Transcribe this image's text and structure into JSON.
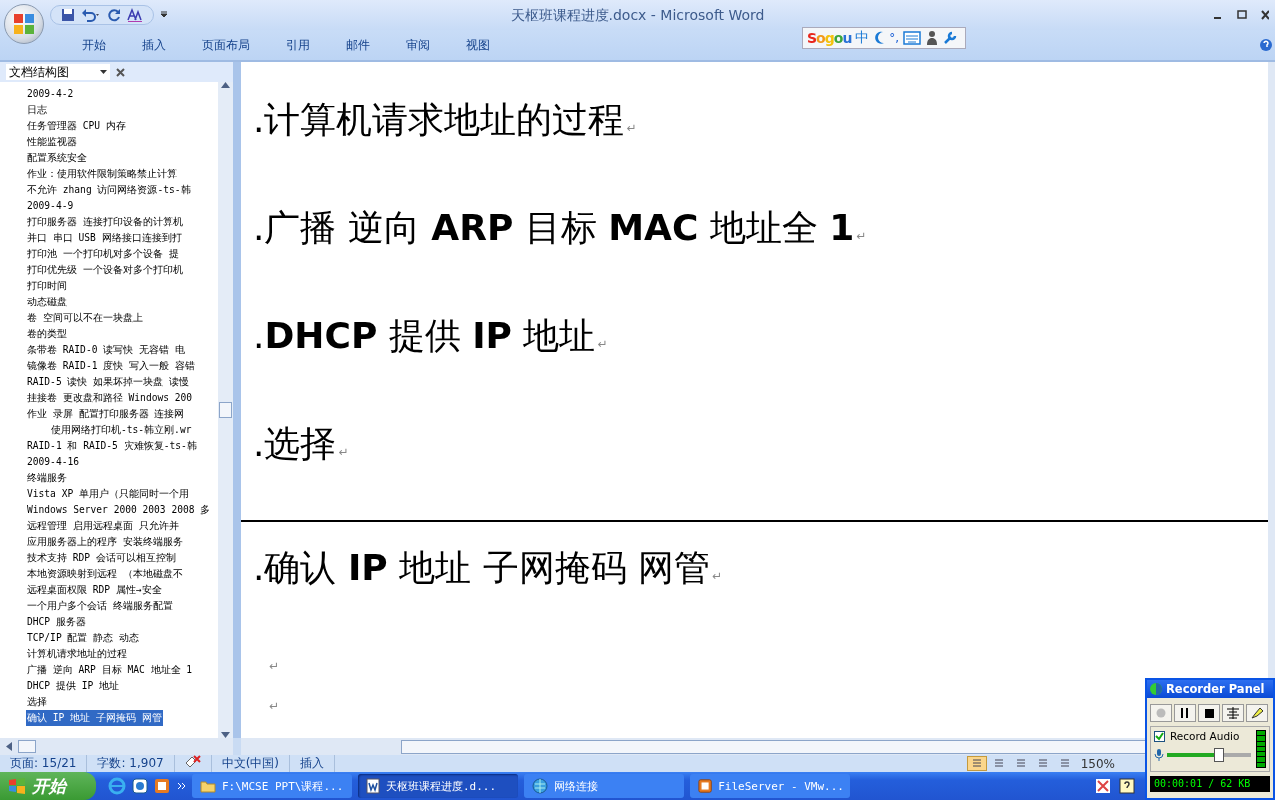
{
  "window": {
    "title": "天枢班课程进度.docx - Microsoft Word"
  },
  "ribbon_tabs": [
    {
      "label": "开始",
      "selected": false
    },
    {
      "label": "插入",
      "selected": false
    },
    {
      "label": "页面布局",
      "selected": false
    },
    {
      "label": "引用",
      "selected": false
    },
    {
      "label": "邮件",
      "selected": false
    },
    {
      "label": "审阅",
      "selected": false
    },
    {
      "label": "视图",
      "selected": false
    }
  ],
  "ime_toolbar": {
    "logo": "Sogou",
    "mode": "中",
    "punctuation": "°,"
  },
  "navigation_pane": {
    "view": "文档结构图",
    "items": [
      {
        "text": "2009-4-2",
        "selected": false
      },
      {
        "text": "日志",
        "selected": false
      },
      {
        "text": "任务管理器 CPU 内存",
        "selected": false
      },
      {
        "text": "性能监视器",
        "selected": false
      },
      {
        "text": "配置系统安全",
        "selected": false
      },
      {
        "text": "作业：使用软件限制策略禁止计算",
        "selected": false
      },
      {
        "text": "不允许 zhang 访问网络资源-ts-韩",
        "selected": false
      },
      {
        "text": "2009-4-9",
        "selected": false
      },
      {
        "text": "打印服务器 连接打印设备的计算机",
        "selected": false
      },
      {
        "text": "并口 串口 USB 网络接口连接到打",
        "selected": false
      },
      {
        "text": "打印池 一个打印机对多个设备 提",
        "selected": false
      },
      {
        "text": "打印优先级 一个设备对多个打印机",
        "selected": false
      },
      {
        "text": "打印时间",
        "selected": false
      },
      {
        "text": "动态磁盘",
        "selected": false
      },
      {
        "text": "卷 空间可以不在一块盘上",
        "selected": false
      },
      {
        "text": "卷的类型",
        "selected": false
      },
      {
        "text": "条带卷 RAID-0 读写快 无容错 电",
        "selected": false
      },
      {
        "text": "镜像卷 RAID-1 度快 写入一般 容错",
        "selected": false
      },
      {
        "text": "RAID-5 读快 如果坏掉一块盘 读慢",
        "selected": false
      },
      {
        "text": "挂接卷 更改盘和路径 Windows 200",
        "selected": false
      },
      {
        "text": "作业 录屏 配置打印服务器 连接网",
        "selected": false,
        "children": [
          {
            "text": "使用网络打印机-ts-韩立刚.wr",
            "selected": false
          }
        ]
      },
      {
        "text": "RAID-1 和 RAID-5 灾难恢复-ts-韩",
        "selected": false
      },
      {
        "text": "2009-4-16",
        "selected": false
      },
      {
        "text": "终端服务",
        "selected": false
      },
      {
        "text": "Vista XP 单用户（只能同时一个用",
        "selected": false
      },
      {
        "text": "Windows Server 2000 2003 2008 多",
        "selected": false
      },
      {
        "text": "远程管理  启用远程桌面 只允许并",
        "selected": false
      },
      {
        "text": "应用服务器上的程序  安装终端服务",
        "selected": false
      },
      {
        "text": "技术支持 RDP 会话可以相互控制",
        "selected": false
      },
      {
        "text": "本地资源映射到远程 （本地磁盘不",
        "selected": false
      },
      {
        "text": "远程桌面权限 RDP 属性→安全",
        "selected": false
      },
      {
        "text": "一个用户多个会话 终端服务配置",
        "selected": false
      },
      {
        "text": "DHCP 服务器",
        "selected": false
      },
      {
        "text": "TCP/IP 配置 静态 动态",
        "selected": false
      },
      {
        "text": "计算机请求地址的过程",
        "selected": false
      },
      {
        "text": "广播 逆向 ARP 目标 MAC 地址全 1",
        "selected": false
      },
      {
        "text": "DHCP 提供 IP 地址",
        "selected": false
      },
      {
        "text": "选择",
        "selected": false
      },
      {
        "text": "确认 IP 地址 子网掩码 网管",
        "selected": true
      }
    ]
  },
  "document": {
    "paragraphs": [
      {
        "kind": "heading",
        "text": ".计算机请求地址的过程",
        "mark": "↵"
      },
      {
        "kind": "heading",
        "text": ".广播 逆向 **ARP** 目标 **MAC** 地址全 **1**",
        "mark": "↵"
      },
      {
        "kind": "heading",
        "text": ".**DHCP** 提供 **IP** 地址",
        "mark": "↵"
      },
      {
        "kind": "heading",
        "text": ".选择",
        "mark": "↵"
      },
      {
        "kind": "page_break"
      },
      {
        "kind": "heading",
        "text": ".确认 **IP** 地址 子网掩码 网管",
        "mark": "↵"
      },
      {
        "kind": "empty",
        "mark": "↵"
      },
      {
        "kind": "empty",
        "mark": "↵"
      }
    ]
  },
  "status_bar": {
    "page": "页面: 15/21",
    "words": "字数: 1,907",
    "language": "中文(中国)",
    "mode": "插入",
    "zoom": "150%",
    "views": [
      {
        "selected": true
      },
      {
        "selected": false
      },
      {
        "selected": false
      },
      {
        "selected": false
      },
      {
        "selected": false
      }
    ]
  },
  "taskbar": {
    "start": "开始",
    "tasks": [
      {
        "kind": "folder",
        "label": "F:\\MCSE PPT\\课程...",
        "selected": false
      },
      {
        "kind": "document",
        "label": "天枢班课程进度.d...",
        "selected": true
      },
      {
        "kind": "network",
        "label": "网络连接",
        "selected": false
      },
      {
        "kind": "vm",
        "label": "FileServer - VMw...",
        "selected": false
      }
    ]
  },
  "recorder_panel": {
    "title": "Recorder Panel",
    "record_audio": {
      "label": "Record Audio",
      "checked": true
    },
    "volume": {
      "level": 0.62
    },
    "timer": "00:00:01 / 62 KB"
  }
}
